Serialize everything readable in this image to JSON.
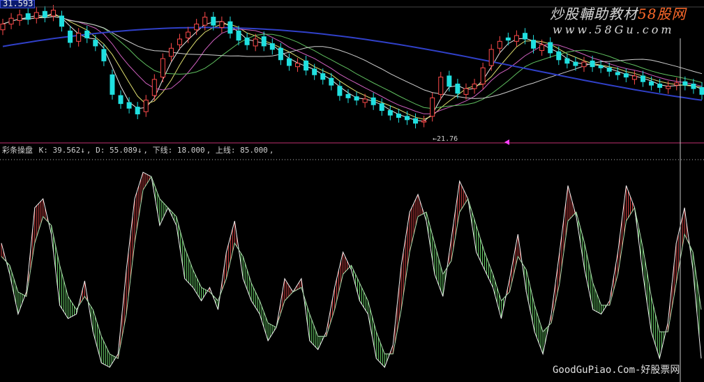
{
  "price_box": "31.593",
  "watermark": {
    "title_main": "炒股輔助教材",
    "title_accent": "58股网",
    "url": "www.58Gu.com",
    "footer": "GoodGuPiao.Com-好股票网"
  },
  "low_marker": "21.76",
  "indicator": {
    "name": "彩条操盘",
    "k": "K: 39.562↓",
    "d": "D: 55.089↓",
    "lower": "下线: 18.000",
    "upper": "上线: 85.000"
  },
  "colors": {
    "up": "#ff4a4a",
    "down": "#20e0e0",
    "ma_white": "#e8e8e8",
    "ma_yellow": "#e0e070",
    "ma_magenta": "#d060c0",
    "ma_green": "#60c060",
    "ma_blue": "#3040c8",
    "divider": "#c03070",
    "k_up": "#ff5050",
    "k_down": "#80ff80"
  },
  "chart_data": [
    {
      "type": "candlestick",
      "title": "",
      "x": [
        0,
        12,
        24,
        36,
        48,
        60,
        72,
        84,
        96,
        108,
        120,
        132,
        144,
        156,
        168,
        180,
        192,
        204,
        216,
        228,
        240,
        252,
        264,
        276,
        288,
        300,
        312,
        324,
        336,
        348,
        360,
        372,
        384,
        396,
        408,
        420,
        432,
        444,
        456,
        468,
        480,
        492,
        504,
        516,
        528,
        540,
        552,
        564,
        576,
        588,
        600,
        612,
        624,
        636,
        648,
        660,
        672,
        684,
        696,
        708,
        720,
        732,
        744,
        756,
        768,
        780,
        792,
        804,
        816,
        828,
        840,
        852,
        864,
        876,
        888,
        900,
        912,
        924,
        936,
        948,
        960,
        972,
        984,
        996
      ],
      "close": [
        30.4,
        30.9,
        31.2,
        30.8,
        31.4,
        31.0,
        31.6,
        30.2,
        28.8,
        29.6,
        29.2,
        28.5,
        27.2,
        24.3,
        23.5,
        23.1,
        22.6,
        23.8,
        25.6,
        27.4,
        28.3,
        29.1,
        29.7,
        30.4,
        31.0,
        30.3,
        30.6,
        29.6,
        29.0,
        28.6,
        29.1,
        28.5,
        28.2,
        27.3,
        26.8,
        27.0,
        26.4,
        26.0,
        25.6,
        25.1,
        24.2,
        24.0,
        23.8,
        23.9,
        23.4,
        22.9,
        22.5,
        22.3,
        22.1,
        21.8,
        22.0,
        24.0,
        25.8,
        25.0,
        24.4,
        24.8,
        25.2,
        26.6,
        28.2,
        28.9,
        29.0,
        29.4,
        29.1,
        28.3,
        28.6,
        27.9,
        27.3,
        27.0,
        26.8,
        27.1,
        26.7,
        26.6,
        26.3,
        26.0,
        25.8,
        25.9,
        25.4,
        25.1,
        24.9,
        25.0,
        25.3,
        25.1,
        24.8,
        24.3
      ],
      "open": [
        29.9,
        30.4,
        30.7,
        31.3,
        30.9,
        31.5,
        31.1,
        31.1,
        29.8,
        28.9,
        29.8,
        29.0,
        28.2,
        26.0,
        24.2,
        23.6,
        23.2,
        22.8,
        24.2,
        25.8,
        27.6,
        28.6,
        29.2,
        29.9,
        30.3,
        31.0,
        30.1,
        30.6,
        29.8,
        29.2,
        28.5,
        29.3,
        28.7,
        28.3,
        27.4,
        26.7,
        27.2,
        26.5,
        26.1,
        25.7,
        25.0,
        24.3,
        24.1,
        23.6,
        24.0,
        23.5,
        22.9,
        22.6,
        22.4,
        22.2,
        21.9,
        22.4,
        24.3,
        25.9,
        25.2,
        24.3,
        24.8,
        25.2,
        26.8,
        28.3,
        29.2,
        28.9,
        29.6,
        29.0,
        28.1,
        28.8,
        28.0,
        27.4,
        27.1,
        26.7,
        27.2,
        26.8,
        26.6,
        26.2,
        26.1,
        25.6,
        25.9,
        25.4,
        25.2,
        24.8,
        25.1,
        25.4,
        25.2,
        24.9
      ],
      "ylim": [
        21.0,
        32.0
      ],
      "low_annotation": 21.76,
      "last_price": 31.593
    },
    {
      "type": "line",
      "title": "彩条操盘",
      "series": [
        {
          "name": "K",
          "values": [
            62,
            48,
            30,
            40,
            78,
            82,
            66,
            34,
            28,
            30,
            45,
            22,
            8,
            6,
            12,
            50,
            82,
            94,
            92,
            70,
            78,
            70,
            46,
            42,
            36,
            42,
            32,
            58,
            72,
            46,
            36,
            30,
            18,
            24,
            46,
            40,
            46,
            18,
            14,
            22,
            42,
            58,
            50,
            36,
            30,
            10,
            6,
            16,
            52,
            76,
            84,
            72,
            48,
            38,
            64,
            90,
            82,
            58,
            50,
            42,
            28,
            46,
            66,
            40,
            22,
            12,
            30,
            58,
            88,
            74,
            50,
            32,
            30,
            36,
            58,
            88,
            78,
            48,
            22,
            10,
            26,
            62,
            78,
            50,
            10
          ]
        },
        {
          "name": "D",
          "values": [
            56,
            52,
            40,
            38,
            62,
            74,
            70,
            52,
            38,
            32,
            38,
            32,
            20,
            12,
            10,
            30,
            62,
            86,
            92,
            82,
            78,
            74,
            60,
            50,
            42,
            40,
            36,
            46,
            62,
            56,
            44,
            36,
            26,
            24,
            36,
            40,
            42,
            30,
            20,
            20,
            32,
            48,
            52,
            44,
            36,
            22,
            12,
            12,
            32,
            58,
            74,
            76,
            62,
            48,
            54,
            76,
            82,
            70,
            58,
            48,
            36,
            40,
            56,
            50,
            34,
            22,
            26,
            44,
            72,
            76,
            62,
            44,
            34,
            34,
            48,
            72,
            78,
            60,
            38,
            22,
            22,
            44,
            66,
            58,
            32
          ]
        }
      ],
      "lower_line": 18.0,
      "upper_line": 85.0,
      "ylim": [
        0,
        100
      ]
    }
  ]
}
